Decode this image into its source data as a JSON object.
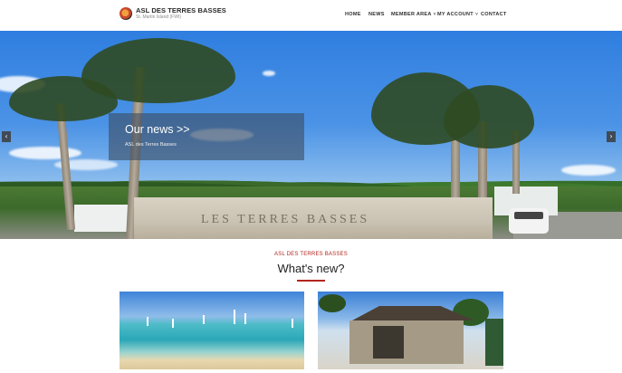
{
  "header": {
    "logo_title": "ASL DES TERRES BASSES",
    "logo_subtitle": "St. Martin Island (FWI)",
    "logo_icon": "circle-logo-icon"
  },
  "nav": {
    "home": "HOME",
    "news": "NEWS",
    "member_area": "MEMBER AREA",
    "my_account": "MY ACCOUNT",
    "contact": "CONTACT",
    "caret": "˅"
  },
  "hero": {
    "heading": "Our news >>",
    "subheading": "ASL des Terres Basses",
    "wall_text": "LES TERRES BASSES",
    "prev_arrow": "‹",
    "next_arrow": "›"
  },
  "section": {
    "kicker": "ASL DES TERRES BASSES",
    "title": "What's new?"
  },
  "colors": {
    "accent": "#b3261e",
    "nav_text": "#2f2f2f",
    "overlay": "#3c4b5f"
  }
}
